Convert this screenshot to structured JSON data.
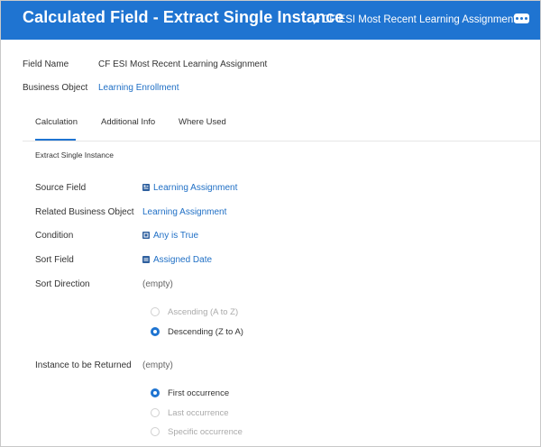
{
  "header": {
    "title": "Calculated Field - Extract Single Instance",
    "subtitle": "CF ESI Most Recent Learning Assignment",
    "edit_icon": "pencil-icon",
    "more_icon": "more-icon",
    "brand_color": "#1f74d1"
  },
  "summary": {
    "field_name_label": "Field Name",
    "field_name_value": "CF ESI Most Recent Learning Assignment",
    "business_object_label": "Business Object",
    "business_object_value": "Learning Enrollment"
  },
  "tabs": [
    {
      "label": "Calculation",
      "active": true
    },
    {
      "label": "Additional Info",
      "active": false
    },
    {
      "label": "Where Used",
      "active": false
    }
  ],
  "section_title": "Extract Single Instance",
  "fields": {
    "source_field": {
      "label": "Source Field",
      "value": "Learning Assignment",
      "icon": "instance-field-icon"
    },
    "related_bo": {
      "label": "Related Business Object",
      "value": "Learning Assignment"
    },
    "condition": {
      "label": "Condition",
      "value": "Any is True",
      "icon": "boolean-field-icon"
    },
    "sort_field": {
      "label": "Sort Field",
      "value": "Assigned Date",
      "icon": "date-field-icon"
    },
    "sort_direction": {
      "label": "Sort Direction",
      "value": "(empty)"
    },
    "instance_returned": {
      "label": "Instance to be Returned",
      "value": "(empty)"
    }
  },
  "sort_direction_options": [
    {
      "label": "Ascending (A to Z)",
      "selected": false
    },
    {
      "label": "Descending (Z to A)",
      "selected": true
    }
  ],
  "instance_options": [
    {
      "label": "First occurrence",
      "selected": true
    },
    {
      "label": "Last occurrence",
      "selected": false
    },
    {
      "label": "Specific occurrence",
      "selected": false
    }
  ]
}
